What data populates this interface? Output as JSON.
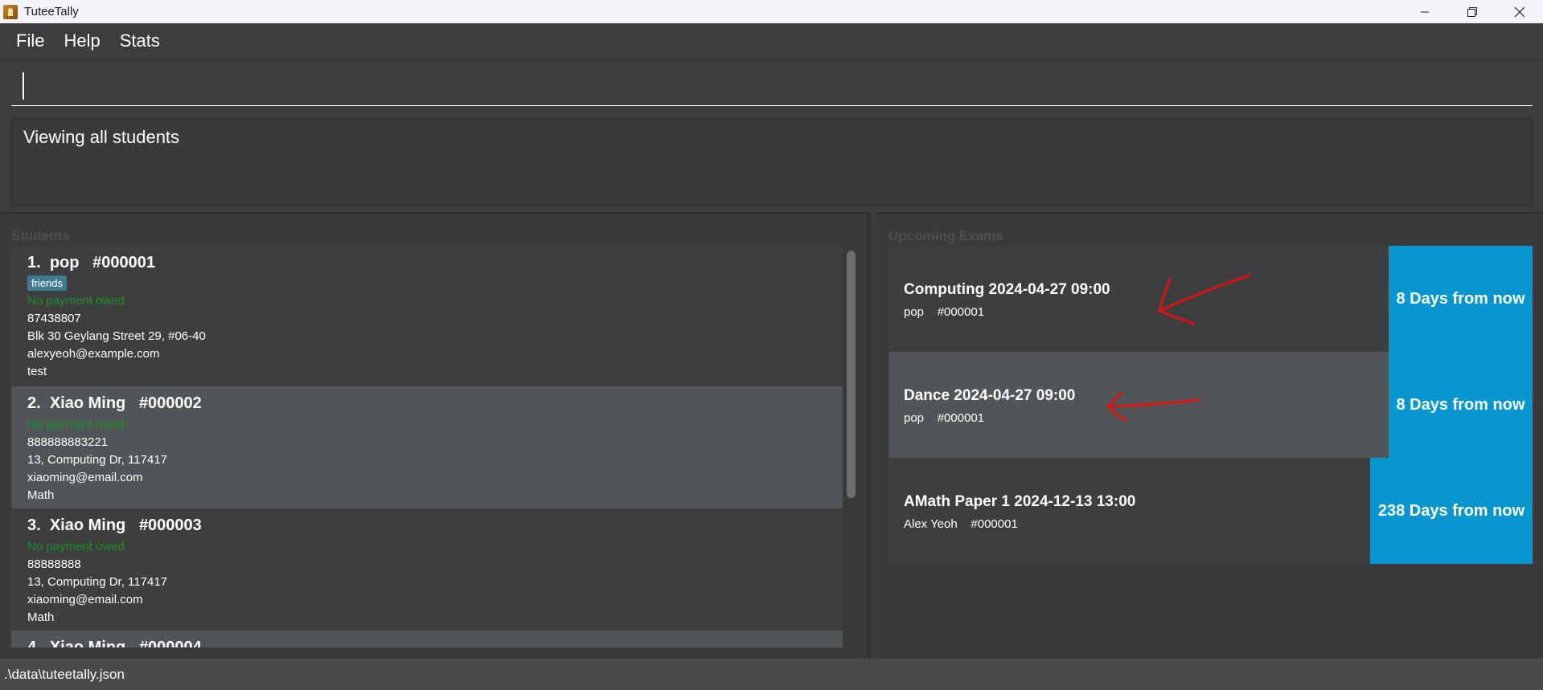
{
  "window": {
    "title": "TuteeTally"
  },
  "menu": {
    "items": [
      "File",
      "Help",
      "Stats"
    ]
  },
  "command": {
    "value": ""
  },
  "result": {
    "text": "Viewing all students"
  },
  "students_panel": {
    "title": "Students",
    "students": [
      {
        "index": "1.",
        "name": "pop",
        "id": "#000001",
        "tag": "friends",
        "payment": "No payment owed",
        "phone": "87438807",
        "address": "Blk 30 Geylang Street 29, #06-40",
        "email": "alexyeoh@example.com",
        "subject": "test"
      },
      {
        "index": "2.",
        "name": "Xiao Ming",
        "id": "#000002",
        "payment": "No payment owed",
        "phone": "888888883221",
        "address": "13, Computing Dr, 117417",
        "email": "xiaoming@email.com",
        "subject": "Math"
      },
      {
        "index": "3.",
        "name": "Xiao Ming",
        "id": "#000003",
        "payment": "No payment owed",
        "phone": "88888888",
        "address": "13, Computing Dr, 117417",
        "email": "xiaoming@email.com",
        "subject": "Math"
      },
      {
        "index": "4.",
        "name": "Xiao Ming",
        "id": "#000004"
      }
    ]
  },
  "exams_panel": {
    "title": "Upcoming Exams",
    "exams": [
      {
        "title": "Computing 2024-04-27 09:00",
        "student": "pop",
        "id": "#000001",
        "days": "8 Days from now"
      },
      {
        "title": "Dance 2024-04-27 09:00",
        "student": "pop",
        "id": "#000001",
        "days": "8 Days from now"
      },
      {
        "title": "AMath Paper 1 2024-12-13 13:00",
        "student": "Alex Yeoh",
        "id": "#000001",
        "days": "238 Days from now"
      }
    ]
  },
  "annotations": {
    "arrow_color": "#e01010"
  },
  "status": {
    "path": ".\\data\\tuteetally.json"
  },
  "colors": {
    "background": "#3d3d3d",
    "accent": "#0596cf",
    "tag": "#3e7b91",
    "payment_green": "#1e8c2a"
  }
}
